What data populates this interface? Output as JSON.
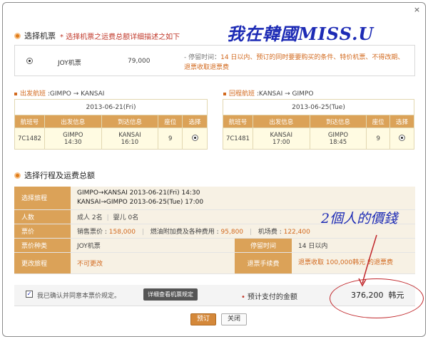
{
  "window": {
    "close_glyph": "×"
  },
  "watermark": "我在韓國MISS.U",
  "select_fare": {
    "title": "选择机票",
    "note": "* 选择机票之运费总额详细描述之如下",
    "fare_name": "JOY机票",
    "fare_price": "79,000",
    "desc_prefix": "- 停留时间：",
    "desc_highlight": "14 日以内、预订的同时要要购买的条件、特价机票、不得改期、退票收取退票费"
  },
  "outbound": {
    "label": "出发航班",
    "route": ":GIMPO → KANSAI",
    "date": "2013-06-21(Fri)",
    "headers": [
      "航班号",
      "出发信息",
      "到达信息",
      "座位",
      "选择"
    ],
    "row": {
      "flight": "7C1482",
      "dep_place": "GIMPO",
      "dep_time": "14:30",
      "arr_place": "KANSAI",
      "arr_time": "16:10",
      "seats": "9"
    }
  },
  "inbound": {
    "label": "回程航班",
    "route": ":KANSAI → GIMPO",
    "date": "2013-06-25(Tue)",
    "headers": [
      "航班号",
      "出发信息",
      "到达信息",
      "座位",
      "选择"
    ],
    "row": {
      "flight": "7C1481",
      "dep_place": "KANSAI",
      "dep_time": "17:00",
      "arr_place": "GIMPO",
      "arr_time": "18:45",
      "seats": "9"
    }
  },
  "summary": {
    "title": "选择行程及运费总额",
    "itinerary_label": "选择旅程",
    "itinerary_1": "GIMPO→KANSAI 2013-06-21(Fri) 14:30",
    "itinerary_2": "KANSAI→GIMPO 2013-06-25(Tue) 17:00",
    "pax_label": "人数",
    "adult": "成人 2名",
    "infant": "婴儿 0名",
    "fare_label": "票价",
    "sales_label": "销售票价 : ",
    "sales_value": "158,000",
    "fuel_label": "燃油附加费及各种费用 : ",
    "fuel_value": "95,800",
    "airport_label": "机场费 : ",
    "airport_value": "122,400",
    "ticket_type_label": "票价种类",
    "ticket_type_value": "JOY机票",
    "stay_label": "停留时间",
    "stay_value": "14 日以内",
    "change_label": "更改旅程",
    "change_value": "不可更改",
    "refund_label": "退票手续费",
    "refund_value": "退票收取 100,000韩元 的退票费"
  },
  "handnote": "2個人的價錢",
  "footer": {
    "check_label": "我已确认并同意本票价规定。",
    "check_mark": "✓",
    "rules_button": "详细查看机票规定",
    "total_bullet": "•",
    "total_label": "预计支付的金额",
    "total_value": "376,200",
    "currency": "韩元"
  },
  "buttons": {
    "confirm": "预订",
    "close": "关闭"
  },
  "colors": {
    "accent": "#dba258",
    "highlight": "#d2691e",
    "annotation": "#1d2bb5",
    "circle": "#c0262a"
  }
}
